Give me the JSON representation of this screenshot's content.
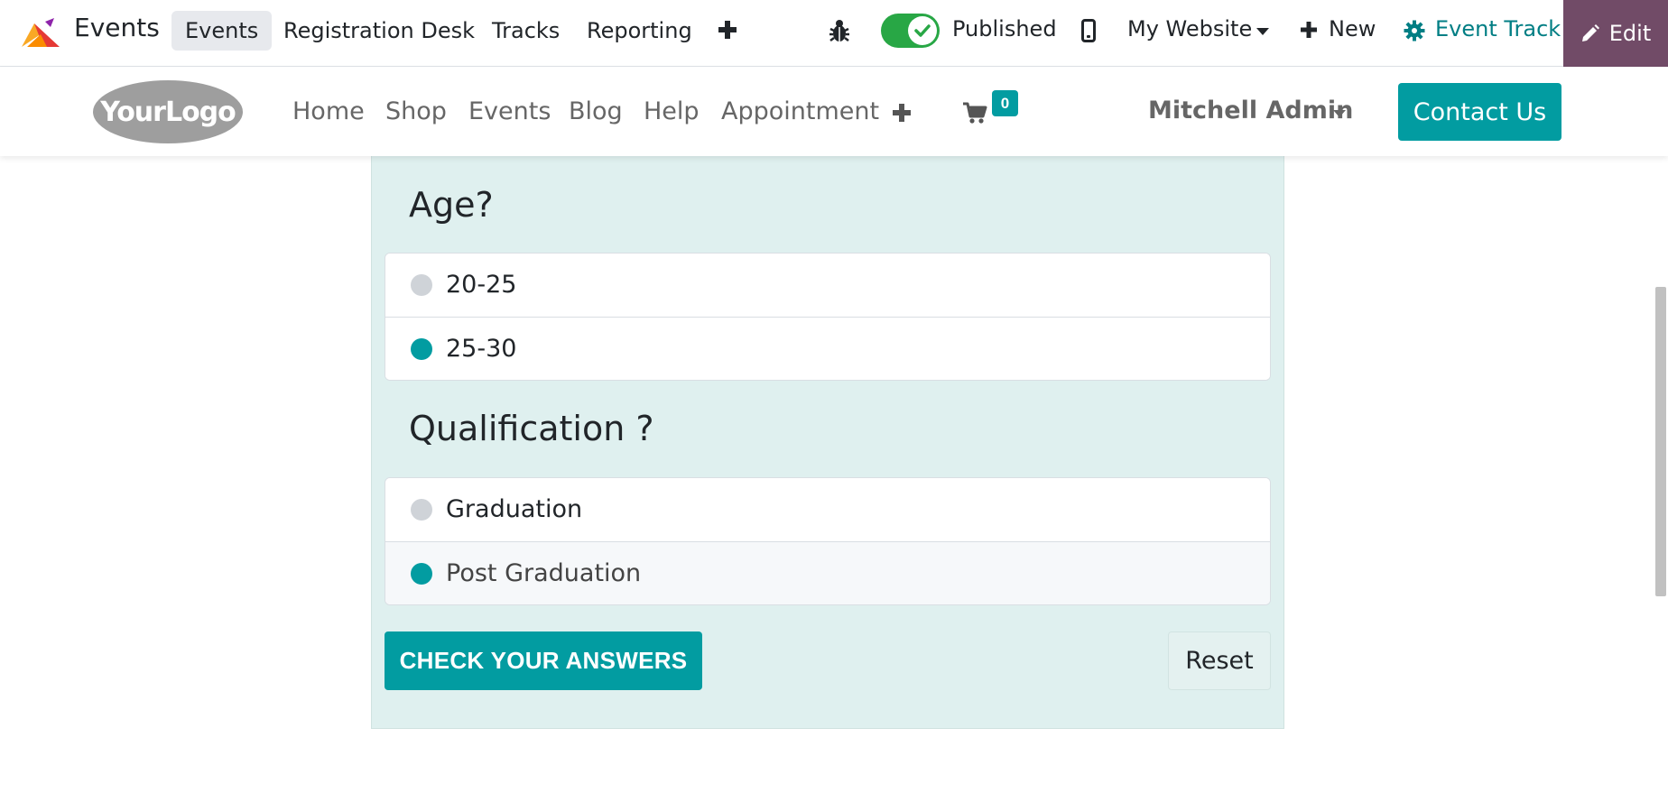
{
  "topbar": {
    "app_name": "Events",
    "menu": [
      "Events",
      "Registration Desk",
      "Tracks",
      "Reporting"
    ],
    "active_menu": "Events",
    "add_menu_icon": "plus-icon",
    "debug_icon": "bug-icon",
    "published_toggle": {
      "label": "Published",
      "on": true
    },
    "device_icon": "mobile-icon",
    "website_switcher": "My Website",
    "new_label": "New",
    "event_track_label": "Event Track",
    "edit_label": "Edit"
  },
  "site_header": {
    "logo_text": "YourLogo",
    "nav": [
      "Home",
      "Shop",
      "Events",
      "Blog",
      "Help",
      "Appointment"
    ],
    "cart_count": "0",
    "user": "Mitchell Admin",
    "contact_label": "Contact Us"
  },
  "quiz": {
    "questions": [
      {
        "title": "Age?",
        "answers": [
          {
            "label": "20-25",
            "checked": false
          },
          {
            "label": "25-30",
            "checked": true
          }
        ]
      },
      {
        "title": "Qualification ?",
        "answers": [
          {
            "label": "Graduation",
            "checked": false
          },
          {
            "label": "Post Graduation",
            "checked": true
          }
        ]
      }
    ],
    "check_label": "CHECK YOUR ANSWERS",
    "reset_label": "Reset"
  },
  "colors": {
    "primary": "#029ca1",
    "edit_bg": "#714b67",
    "toggle_on": "#28a745",
    "card_bg": "#dff0ef",
    "event_track_text": "#017e84"
  }
}
